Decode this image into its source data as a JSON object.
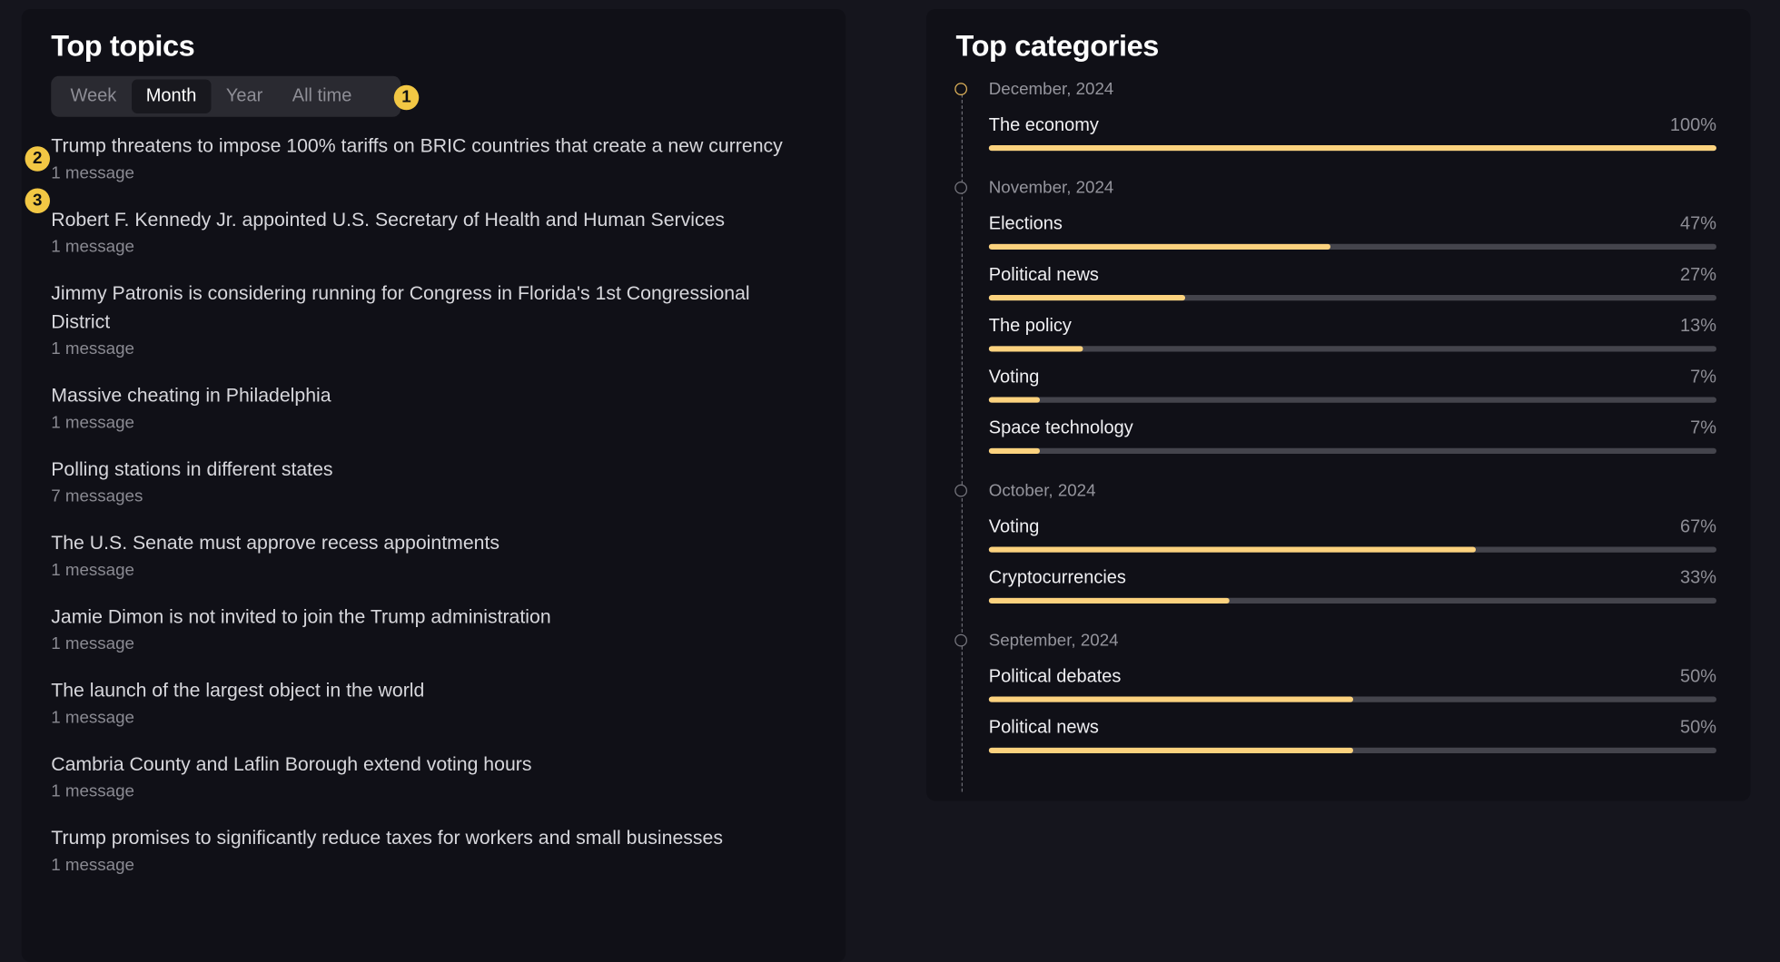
{
  "colors": {
    "accent": "#fcd27e",
    "badge": "#f2c744",
    "track": "#44444c",
    "panel": "#101017",
    "background": "#15151d"
  },
  "top_topics": {
    "title": "Top topics",
    "tabs": [
      {
        "label": "Week",
        "active": false
      },
      {
        "label": "Month",
        "active": true
      },
      {
        "label": "Year",
        "active": false
      },
      {
        "label": "All time",
        "active": false
      }
    ],
    "items": [
      {
        "title": "Trump threatens to impose 100% tariffs on BRIC countries that create a new currency",
        "meta": "1 message"
      },
      {
        "title": "Robert F. Kennedy Jr. appointed U.S. Secretary of Health and Human Services",
        "meta": "1 message"
      },
      {
        "title": "Jimmy Patronis is considering running for Congress in Florida's 1st Congressional District",
        "meta": "1 message"
      },
      {
        "title": "Massive cheating in Philadelphia",
        "meta": "1 message"
      },
      {
        "title": "Polling stations in different states",
        "meta": "7 messages"
      },
      {
        "title": "The U.S. Senate must approve recess appointments",
        "meta": "1 message"
      },
      {
        "title": "Jamie Dimon is not invited to join the Trump administration",
        "meta": "1 message"
      },
      {
        "title": "The launch of the largest object in the world",
        "meta": "1 message"
      },
      {
        "title": "Cambria County and Laflin Borough extend voting hours",
        "meta": "1 message"
      },
      {
        "title": "Trump promises to significantly reduce taxes for workers and small businesses",
        "meta": "1 message"
      }
    ]
  },
  "annotations": [
    "1",
    "2",
    "3"
  ],
  "top_categories": {
    "title": "Top categories",
    "months": [
      {
        "label": "December, 2024",
        "current": true,
        "categories": [
          {
            "name": "The economy",
            "pct_label": "100%",
            "value": 100
          }
        ]
      },
      {
        "label": "November, 2024",
        "current": false,
        "categories": [
          {
            "name": "Elections",
            "pct_label": "47%",
            "value": 47
          },
          {
            "name": "Political news",
            "pct_label": "27%",
            "value": 27
          },
          {
            "name": "The policy",
            "pct_label": "13%",
            "value": 13
          },
          {
            "name": "Voting",
            "pct_label": "7%",
            "value": 7
          },
          {
            "name": "Space technology",
            "pct_label": "7%",
            "value": 7
          }
        ]
      },
      {
        "label": "October, 2024",
        "current": false,
        "categories": [
          {
            "name": "Voting",
            "pct_label": "67%",
            "value": 67
          },
          {
            "name": "Cryptocurrencies",
            "pct_label": "33%",
            "value": 33
          }
        ]
      },
      {
        "label": "September, 2024",
        "current": false,
        "categories": [
          {
            "name": "Political debates",
            "pct_label": "50%",
            "value": 50
          },
          {
            "name": "Political news",
            "pct_label": "50%",
            "value": 50
          }
        ]
      }
    ]
  }
}
